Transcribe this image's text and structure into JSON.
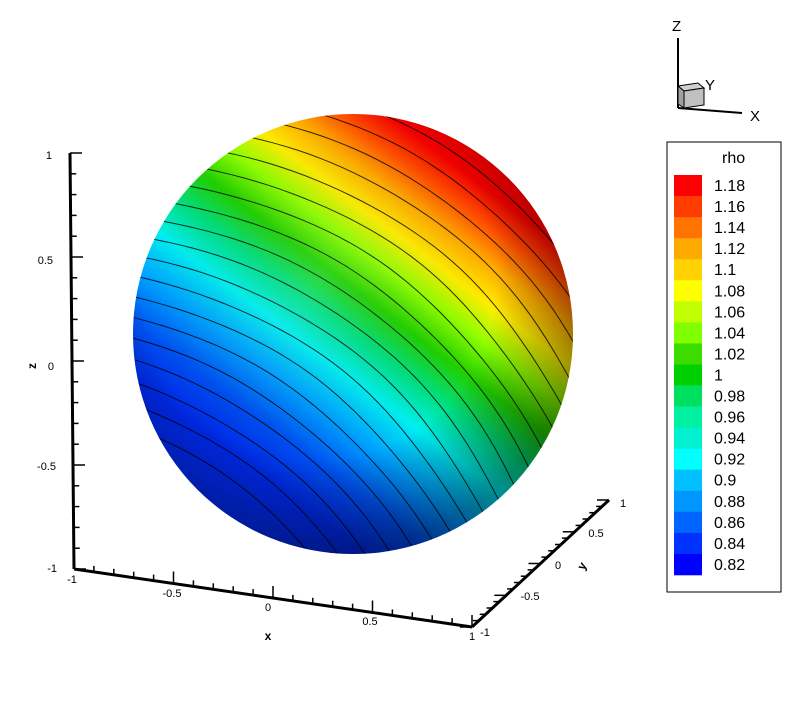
{
  "chart_data": {
    "type": "contour",
    "variable": "rho",
    "legend": {
      "title": "rho",
      "levels": [
        "1.18",
        "1.16",
        "1.14",
        "1.12",
        "1.1",
        "1.08",
        "1.06",
        "1.04",
        "1.02",
        "1",
        "0.98",
        "0.96",
        "0.94",
        "0.92",
        "0.9",
        "0.88",
        "0.86",
        "0.84",
        "0.82"
      ],
      "colors": [
        "#ff0000",
        "#ff3c00",
        "#ff7300",
        "#ffaa00",
        "#ffd200",
        "#ffff00",
        "#c0ff00",
        "#80ff00",
        "#3cdc00",
        "#00d000",
        "#00e060",
        "#00f0a0",
        "#00f0d0",
        "#00ffff",
        "#00c0ff",
        "#0096ff",
        "#0064ff",
        "#0032ff",
        "#0000ff"
      ],
      "placement": "right"
    },
    "range": [
      0.82,
      1.18
    ],
    "axes": {
      "z": {
        "label": "z",
        "ticks": [
          "1",
          "0.5",
          "0",
          "-0.5",
          "-1"
        ],
        "range": [
          -1,
          1
        ]
      },
      "x": {
        "label": "x",
        "ticks": [
          "-1",
          "-0.5",
          "0",
          "0.5",
          "1"
        ],
        "range": [
          -1,
          1
        ]
      },
      "y": {
        "label": "y",
        "ticks": [
          "-1",
          "-0.5",
          "0",
          "0.5",
          "1"
        ],
        "range": [
          -1,
          1
        ]
      }
    },
    "orientation_triad": {
      "labels": [
        "Z",
        "Y",
        "X"
      ]
    }
  }
}
